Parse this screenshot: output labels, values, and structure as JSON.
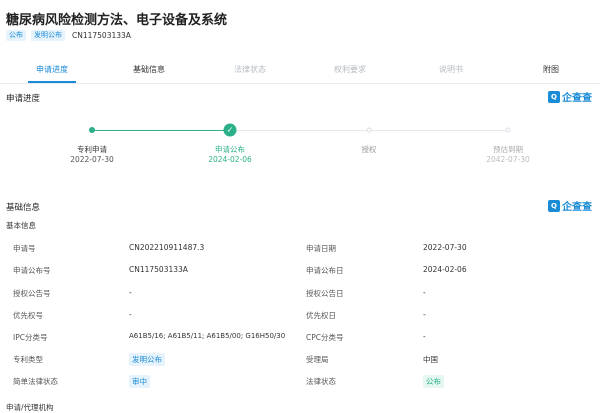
{
  "header": {
    "title": "糖尿病风险检测方法、电子设备及系统",
    "tag_public": "公布",
    "tag_type": "发明公布",
    "pub_number": "CN117503133A"
  },
  "tabs": [
    {
      "label": "申请进度",
      "state": "active"
    },
    {
      "label": "基础信息",
      "state": "dark"
    },
    {
      "label": "法律状态",
      "state": "muted"
    },
    {
      "label": "权利要求",
      "state": "muted"
    },
    {
      "label": "说明书",
      "state": "muted"
    },
    {
      "label": "附图",
      "state": "dark"
    }
  ],
  "progress_section": {
    "title": "申请进度",
    "brand": "企查查",
    "brand_icon_text": "Q",
    "steps": [
      {
        "label": "专利申请",
        "date": "2022-07-30",
        "status": "done"
      },
      {
        "label": "申请公布",
        "date": "2024-02-06",
        "status": "current"
      },
      {
        "label": "授权",
        "date": "",
        "status": "pending"
      },
      {
        "label": "预估到期",
        "date": "2042-07-30",
        "status": "pending"
      }
    ],
    "colors": {
      "done": "#2bb08a",
      "pending": "#d9dde3"
    }
  },
  "basic_section": {
    "title": "基础信息",
    "brand": "企查查",
    "brand_icon_text": "Q",
    "subhead": "基本信息",
    "rows": [
      {
        "l_label": "申请号",
        "l_value": "CN202210911487.3",
        "r_label": "申请日期",
        "r_value": "2022-07-30"
      },
      {
        "l_label": "申请公布号",
        "l_value": "CN117503133A",
        "r_label": "申请公布日",
        "r_value": "2024-02-06"
      },
      {
        "l_label": "授权公告号",
        "l_value": "-",
        "r_label": "授权公告日",
        "r_value": "-"
      },
      {
        "l_label": "优先权号",
        "l_value": "-",
        "r_label": "优先权日",
        "r_value": "-"
      },
      {
        "l_label": "IPC分类号",
        "l_value": "A61B5/16;  A61B5/11;  A61B5/00;  G16H50/30",
        "r_label": "CPC分类号",
        "r_value": "-"
      },
      {
        "l_label": "专利类型",
        "l_value": "发明公布",
        "r_label": "受理局",
        "r_value": "中国"
      },
      {
        "l_label": "简单法律状态",
        "l_value": "审中",
        "r_label": "法律状态",
        "r_value": "公布"
      }
    ]
  },
  "bottom_heading": "申请/代理机构"
}
